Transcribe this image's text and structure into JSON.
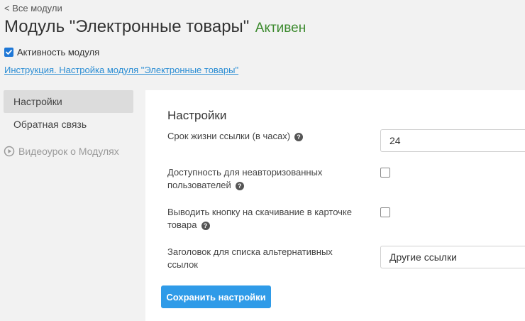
{
  "back_link": "< Все модули",
  "header": {
    "title": "Модуль \"Электронные товары\"",
    "status": "Активен",
    "status_color": "#3c8a2e"
  },
  "module_active": {
    "label": "Активность модуля",
    "checked": true
  },
  "instruction_link": "Инструкция. Настройка модуля \"Электронные товары\"",
  "sidebar": {
    "items": [
      {
        "label": "Настройки",
        "active": true
      },
      {
        "label": "Обратная связь",
        "active": false
      }
    ],
    "video_label": "Видеоурок о Модулях"
  },
  "settings": {
    "title": "Настройки",
    "link_lifetime": {
      "label": "Срок жизни ссылки (в часах)",
      "value": "24"
    },
    "unauthorized_access": {
      "label_line1": "Доступность для неавторизованных",
      "label_line2": "пользователей",
      "checked": false
    },
    "download_button": {
      "label_line1": "Выводить кнопку на скачивание в карточке",
      "label_line2": "товара",
      "checked": false
    },
    "alt_links_header": {
      "label_line1": "Заголовок для списка альтернативных",
      "label_line2": "ссылок",
      "value": "Другие ссылки"
    },
    "save_label": "Сохранить настройки"
  },
  "colors": {
    "accent": "#2f9be8",
    "link": "#2a8dd4",
    "active_sidebar": "#dcdcdc"
  }
}
